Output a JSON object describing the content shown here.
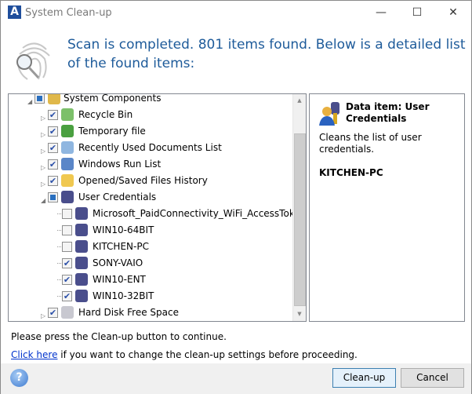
{
  "window": {
    "title": "System Clean-up",
    "logo": "A"
  },
  "heading": "Scan is completed. 801 items found. Below is a detailed list of the found items:",
  "tree": {
    "root": {
      "label": "System Components",
      "state": "partial"
    },
    "items": [
      {
        "label": "Recycle Bin",
        "checked": true,
        "icon": "recycle-bin-icon"
      },
      {
        "label": "Temporary file",
        "checked": true,
        "icon": "temporary-file-icon"
      },
      {
        "label": "Recently Used Documents List",
        "checked": true,
        "icon": "recent-documents-icon"
      },
      {
        "label": "Windows Run List",
        "checked": true,
        "icon": "run-list-icon"
      },
      {
        "label": "Opened/Saved Files History",
        "checked": true,
        "icon": "folder-history-icon"
      },
      {
        "label": "User Credentials",
        "checked": "partial",
        "icon": "user-credentials-icon",
        "expanded": true,
        "children": [
          {
            "label": "Microsoft_PaidConnectivity_WiFi_AccessToken",
            "checked": false
          },
          {
            "label": "WIN10-64BIT",
            "checked": false
          },
          {
            "label": "KITCHEN-PC",
            "checked": false,
            "selected": true
          },
          {
            "label": "SONY-VAIO",
            "checked": true
          },
          {
            "label": "WIN10-ENT",
            "checked": true
          },
          {
            "label": "WIN10-32BIT",
            "checked": true
          }
        ]
      },
      {
        "label": "Hard Disk Free Space",
        "checked": true,
        "icon": "hard-disk-icon"
      }
    ]
  },
  "info": {
    "title": "Data item: User Credentials",
    "description": "Cleans the list of user credentials.",
    "selected": "KITCHEN-PC"
  },
  "messages": {
    "continue": "Please press the Clean-up button to continue.",
    "link": "Click here",
    "link_rest": " if you want to change the clean-up settings before proceeding."
  },
  "buttons": {
    "cleanup": "Clean-up",
    "cancel": "Cancel",
    "help": "?"
  },
  "colors": {
    "heading": "#1e5b9a",
    "link": "#0033cc",
    "selection": "#e5f3fb"
  }
}
